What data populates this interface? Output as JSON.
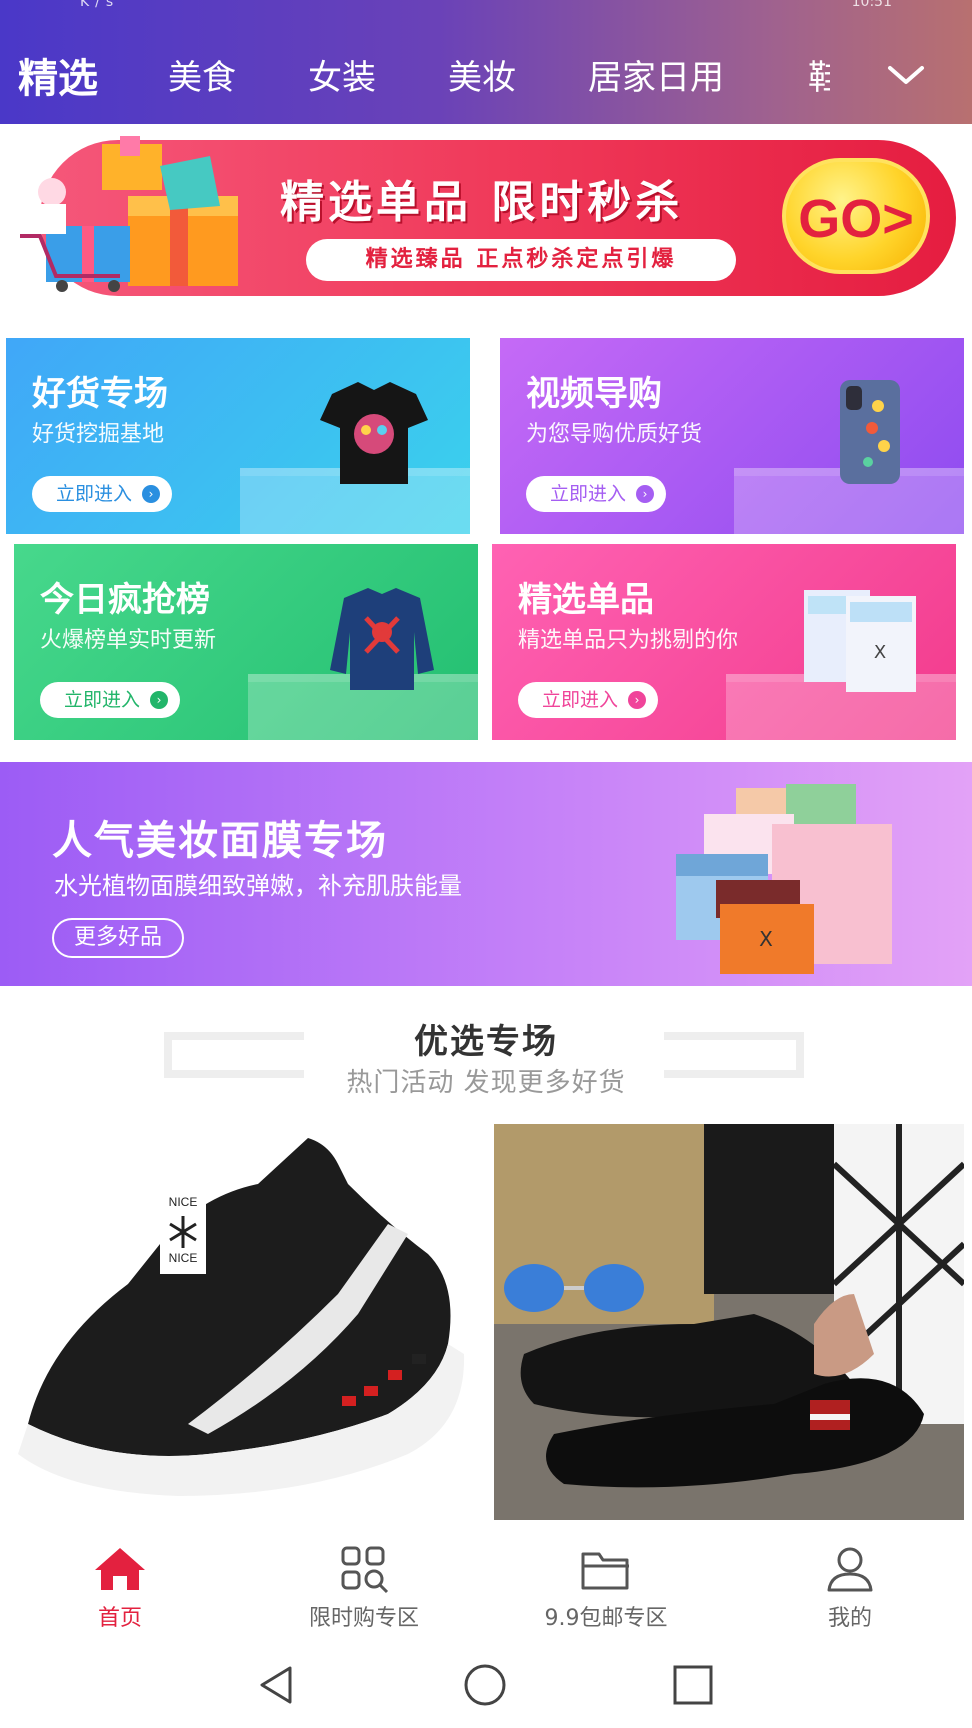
{
  "status_bar": {
    "left": "K/s",
    "right": "10:51"
  },
  "categories": {
    "items": [
      "精选",
      "美食",
      "女装",
      "美妆",
      "居家日用",
      "鞋"
    ],
    "active_index": 0,
    "more_icon": "chevron-down-icon"
  },
  "flash_sale": {
    "title": "精选单品  限时秒杀",
    "subtitle": "精选臻品  正点秒杀定点引爆",
    "go_label": "GO>"
  },
  "feature_cards": [
    {
      "title": "好货专场",
      "subtitle": "好货挖掘基地",
      "button": "立即进入",
      "product_icon": "tshirt-icon"
    },
    {
      "title": "视频导购",
      "subtitle": "为您导购优质好货",
      "button": "立即进入",
      "product_icon": "phone-case-icon"
    },
    {
      "title": "今日疯抢榜",
      "subtitle": "火爆榜单实时更新",
      "button": "立即进入",
      "product_icon": "sweater-icon"
    },
    {
      "title": "精选单品",
      "subtitle": "精选单品只为挑剔的你",
      "button": "立即进入",
      "product_icon": "mask-box-icon"
    }
  ],
  "mask_banner": {
    "title": "人气美妆面膜专场",
    "subtitle": "水光植物面膜细致弹嫩，补充肌肤能量",
    "button": "更多好品"
  },
  "section": {
    "title": "优选专场",
    "subtitle": "热门活动 发现更多好货"
  },
  "products": [
    {
      "name": "sneaker-image"
    },
    {
      "name": "loafer-image"
    }
  ],
  "bottom_nav": [
    {
      "label": "首页",
      "icon": "home-icon"
    },
    {
      "label": "限时购专区",
      "icon": "grid-search-icon"
    },
    {
      "label": "9.9包邮专区",
      "icon": "folder-icon"
    },
    {
      "label": "我的",
      "icon": "user-icon"
    }
  ],
  "colors": {
    "accent": "#e3213f",
    "header_start": "#4a38c8",
    "header_end": "#b87070"
  }
}
